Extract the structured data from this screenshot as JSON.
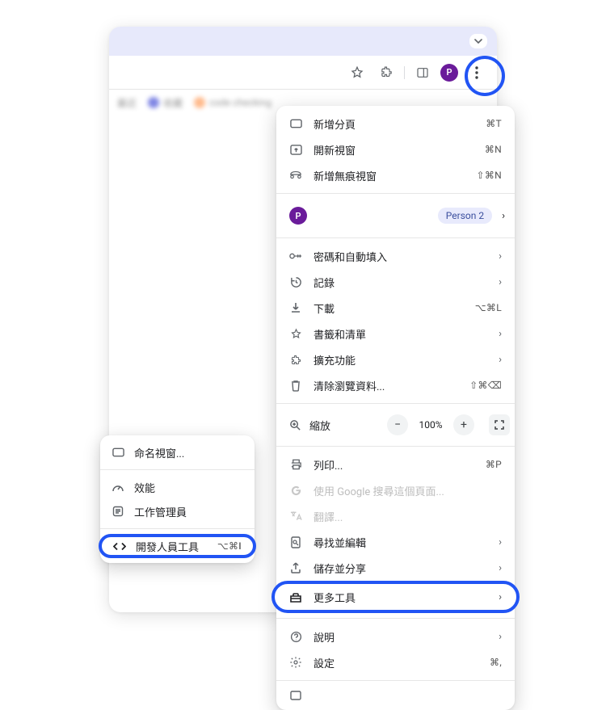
{
  "profile": {
    "initial": "P",
    "badge": "Person 2"
  },
  "bookmarks": [
    "最近",
    "收藏",
    "code checking"
  ],
  "menu": {
    "new_tab": {
      "label": "新增分頁",
      "shortcut": "⌘T"
    },
    "new_window": {
      "label": "開新視窗",
      "shortcut": "⌘N"
    },
    "new_incognito": {
      "label": "新增無痕視窗",
      "shortcut": "⇧⌘N"
    },
    "passwords": {
      "label": "密碼和自動填入"
    },
    "history": {
      "label": "記錄"
    },
    "downloads": {
      "label": "下載",
      "shortcut": "⌥⌘L"
    },
    "bookmarks_lists": {
      "label": "書籤和清單"
    },
    "extensions": {
      "label": "擴充功能"
    },
    "clear_data": {
      "label": "清除瀏覽資料...",
      "shortcut": "⇧⌘⌫"
    },
    "zoom": {
      "label": "縮放",
      "value": "100%"
    },
    "print": {
      "label": "列印...",
      "shortcut": "⌘P"
    },
    "google_search": {
      "label": "使用 Google 搜尋這個頁面..."
    },
    "translate": {
      "label": "翻譯..."
    },
    "find_edit": {
      "label": "尋找並編輯"
    },
    "save_share": {
      "label": "儲存並分享"
    },
    "more_tools": {
      "label": "更多工具"
    },
    "help": {
      "label": "說明"
    },
    "settings": {
      "label": "設定",
      "shortcut": "⌘,"
    }
  },
  "submenu": {
    "name_window": {
      "label": "命名視窗..."
    },
    "performance": {
      "label": "效能"
    },
    "task_manager": {
      "label": "工作管理員"
    },
    "dev_tools": {
      "label": "開發人員工具",
      "shortcut": "⌥⌘I"
    }
  }
}
